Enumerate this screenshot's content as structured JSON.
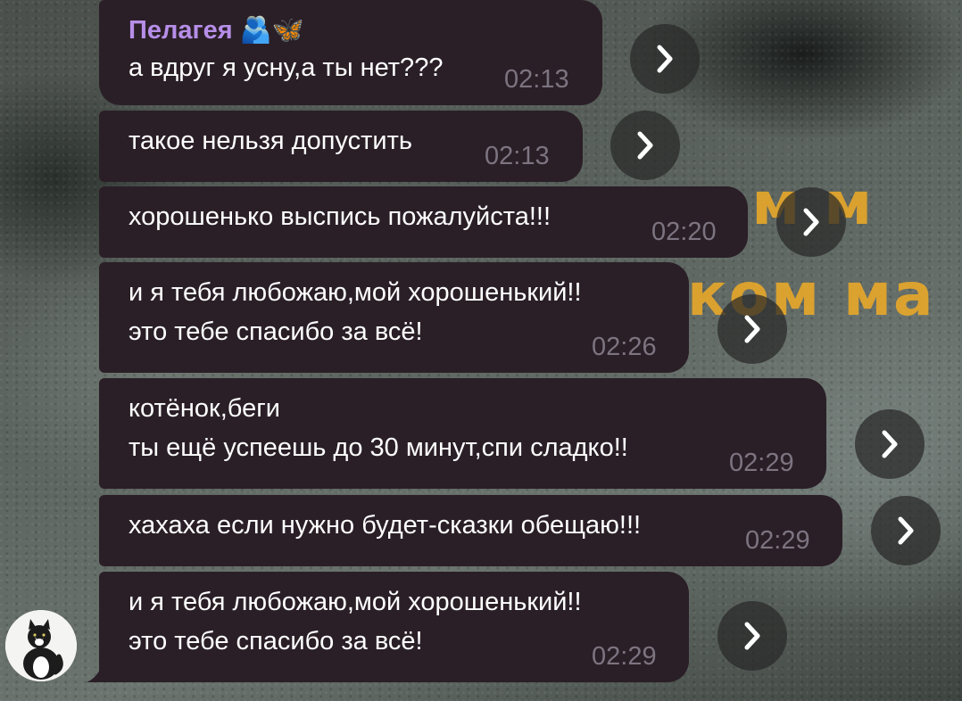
{
  "chat": {
    "sender_name": "Пелагея",
    "sender_emoji": "🫂🦋",
    "messages": [
      {
        "lines": [
          "а вдруг я усну,а ты нет???"
        ],
        "time": "02:13"
      },
      {
        "lines": [
          "такое нельзя допустить"
        ],
        "time": "02:13"
      },
      {
        "lines": [
          "хорошенько выспись пожалуйста!!!"
        ],
        "time": "02:20"
      },
      {
        "lines": [
          "и я тебя любожаю,мой хорошенький!!",
          "это тебе спасибо за всё!"
        ],
        "time": "02:26"
      },
      {
        "lines": [
          "котёнок,беги",
          "ты ещё успеешь до 30 минут,спи сладко!!"
        ],
        "time": "02:29"
      },
      {
        "lines": [
          "хахаха если нужно будет-сказки обещаю!!!"
        ],
        "time": "02:29"
      },
      {
        "lines": [
          "и я тебя любожаю,мой хорошенький!!",
          "это тебе спасибо за всё!"
        ],
        "time": "02:29"
      }
    ]
  },
  "wallpaper": {
    "caption_line1": "ом м",
    "caption_line2": "ком ма"
  },
  "icons": {
    "forward": "chevron-right-icon",
    "avatar": "cat-avatar"
  },
  "colors": {
    "bubble_bg": "#2a1f27",
    "sender_name": "#b68ee8",
    "timestamp": "#7d7481",
    "caption": "#e8a82a"
  }
}
